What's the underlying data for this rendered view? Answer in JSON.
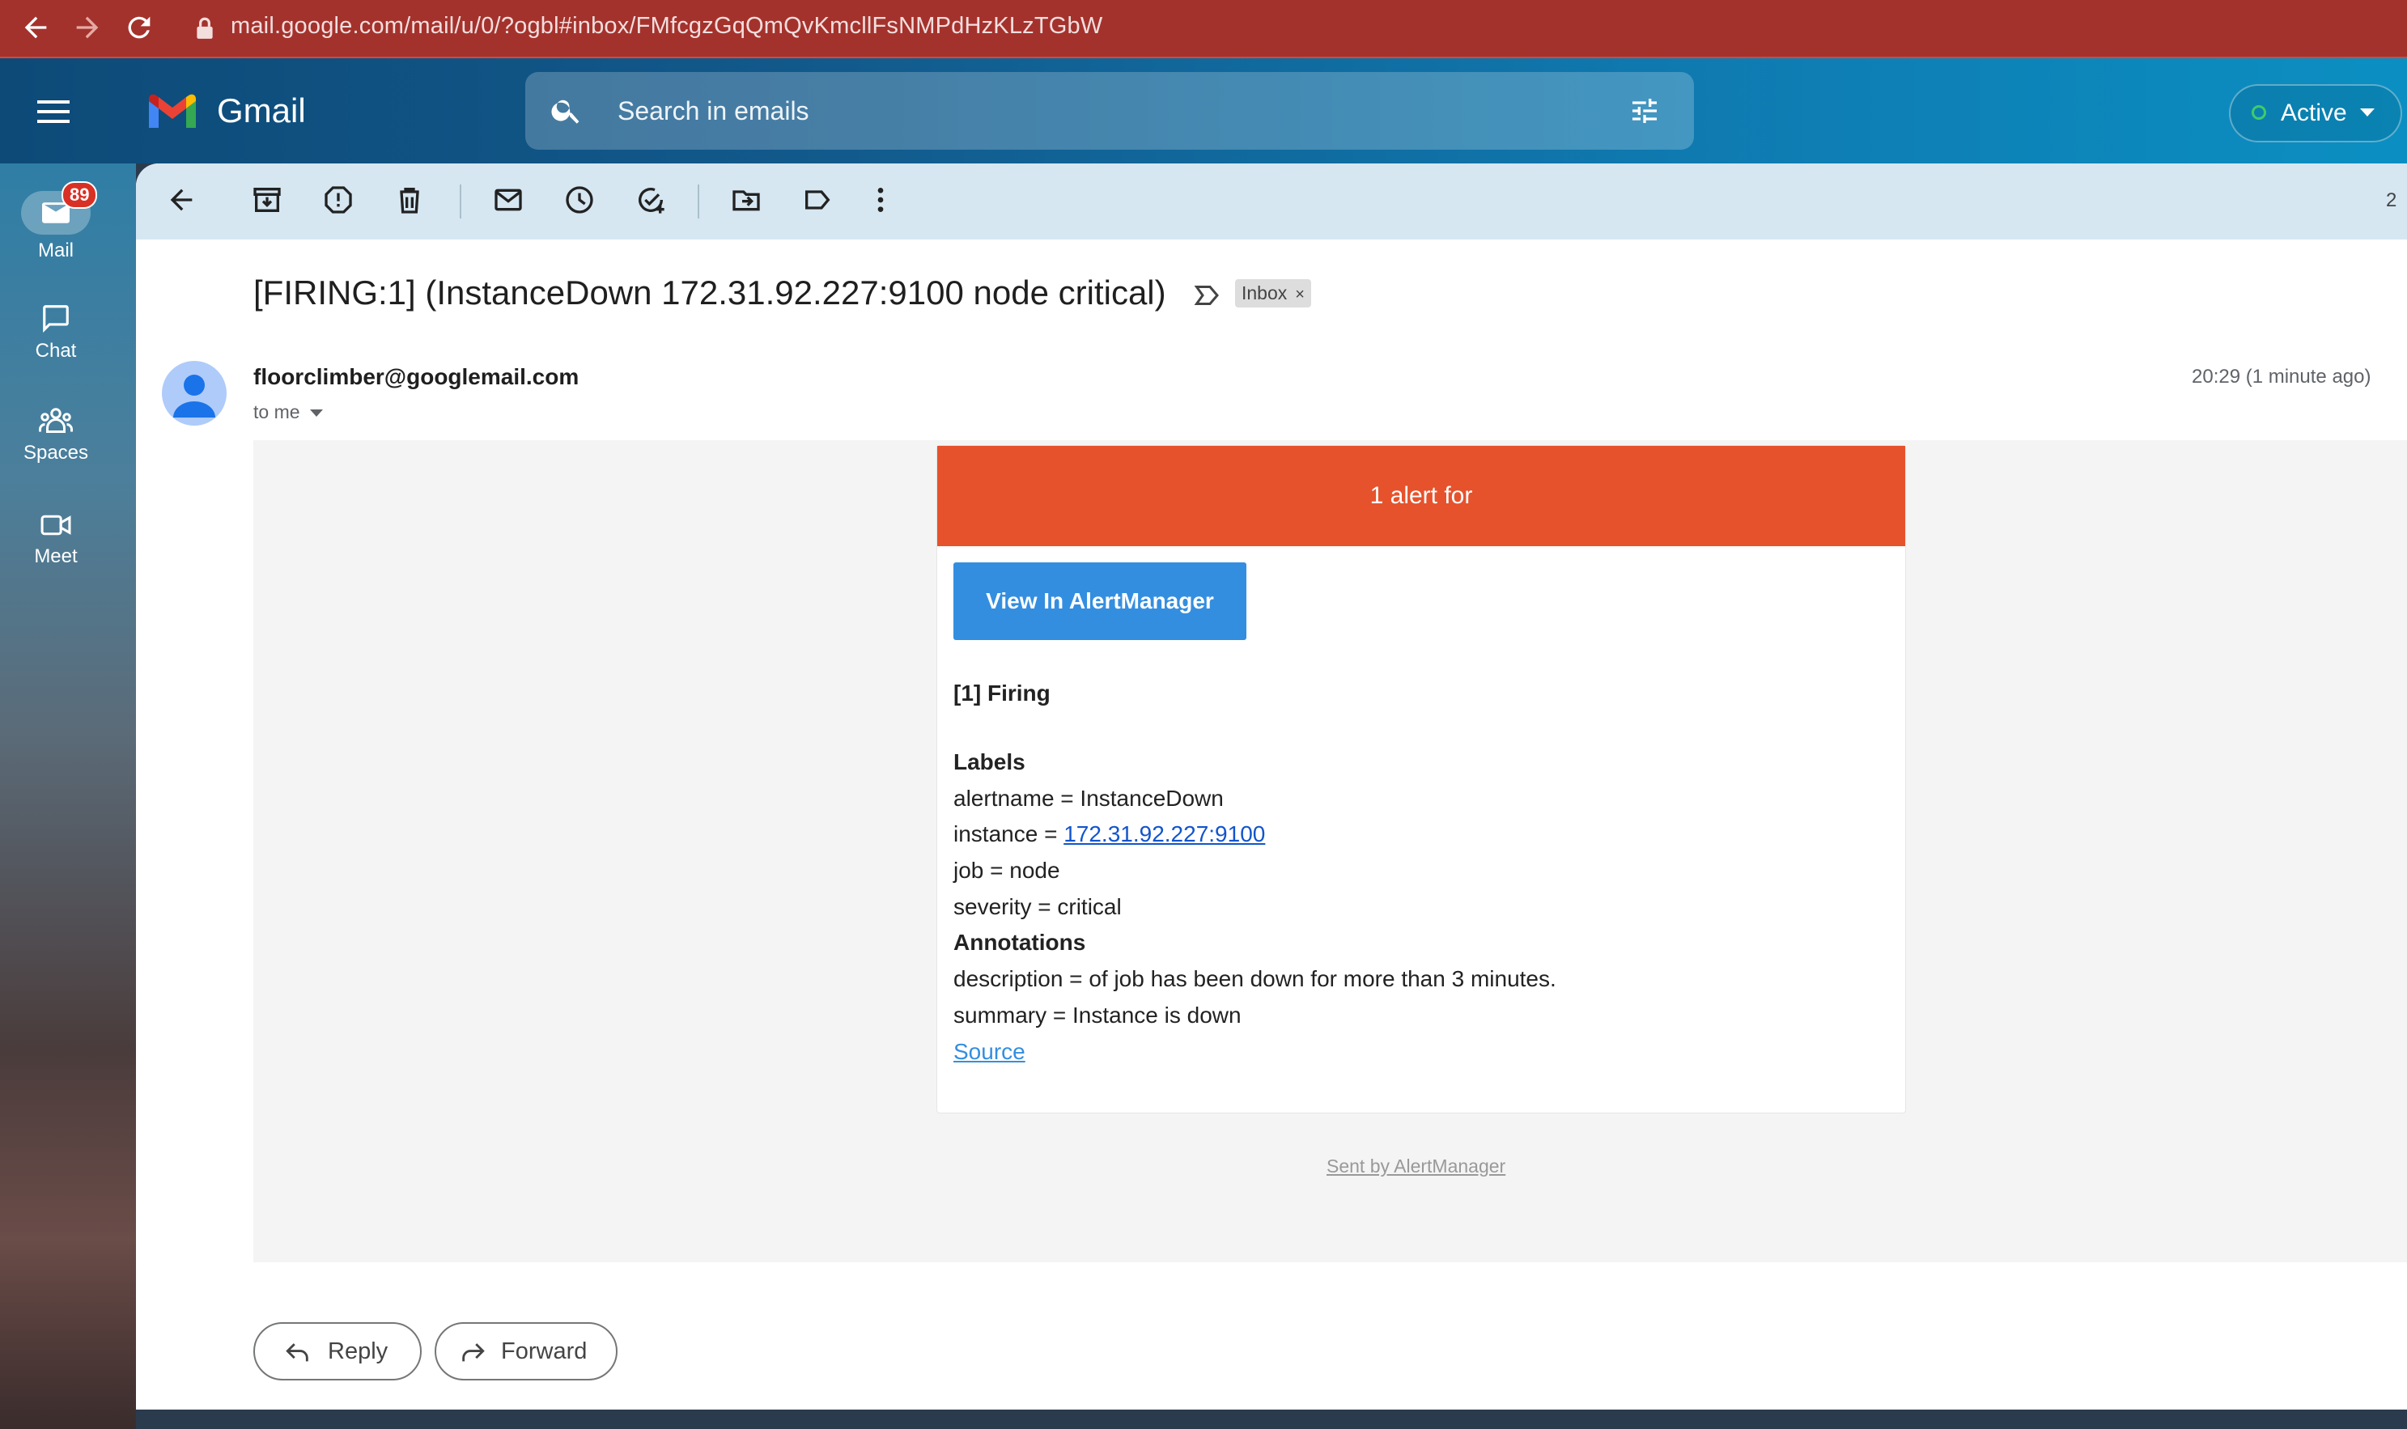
{
  "browser": {
    "url": "mail.google.com/mail/u/0/?ogbl#inbox/FMfcgzGqQmQvKmcllFsNMPdHzKLzTGbW"
  },
  "app": {
    "name": "Gmail",
    "search_placeholder": "Search in emails",
    "status": "Active"
  },
  "rail": {
    "items": [
      {
        "label": "Mail",
        "icon": "mail-icon",
        "badge": "89"
      },
      {
        "label": "Chat",
        "icon": "chat-icon"
      },
      {
        "label": "Spaces",
        "icon": "spaces-icon"
      },
      {
        "label": "Meet",
        "icon": "meet-icon"
      }
    ]
  },
  "toolbar": {
    "count": "2"
  },
  "email": {
    "subject": "[FIRING:1] (InstanceDown 172.31.92.227:9100 node critical)",
    "label": "Inbox",
    "label_remove": "×",
    "sender": "floorclimber@googlemail.com",
    "recipient": "to me",
    "timestamp": "20:29 (1 minute ago)",
    "body": {
      "header": "1 alert for",
      "button": "View In AlertManager",
      "firing": "[1] Firing",
      "labels_heading": "Labels",
      "alertname": "alertname = InstanceDown",
      "instance_prefix": "instance = ",
      "instance_link": "172.31.92.227:9100",
      "job": "job = node",
      "severity": "severity = critical",
      "annotations_heading": "Annotations",
      "description": "description = of job has been down for more than 3 minutes.",
      "summary": "summary = Instance is down",
      "source": "Source",
      "sent_by": "Sent by AlertManager"
    }
  },
  "actions": {
    "reply": "Reply",
    "forward": "Forward"
  },
  "colors": {
    "alert_header": "#e6522c",
    "view_button": "#348ee0",
    "browser_bar": "#a4322c"
  }
}
